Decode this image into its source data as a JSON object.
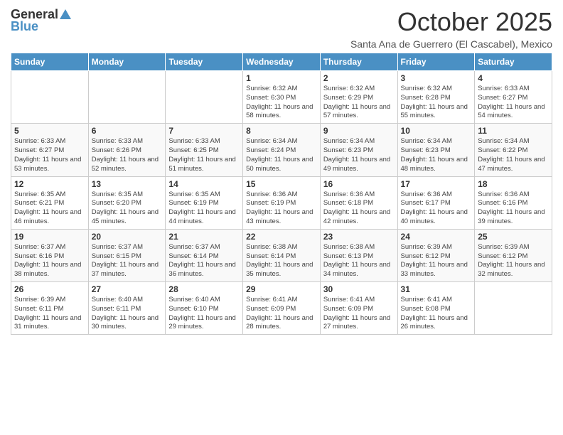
{
  "logo": {
    "general": "General",
    "blue": "Blue"
  },
  "header": {
    "month": "October 2025",
    "subtitle": "Santa Ana de Guerrero (El Cascabel), Mexico"
  },
  "weekdays": [
    "Sunday",
    "Monday",
    "Tuesday",
    "Wednesday",
    "Thursday",
    "Friday",
    "Saturday"
  ],
  "weeks": [
    [
      {
        "day": "",
        "info": ""
      },
      {
        "day": "",
        "info": ""
      },
      {
        "day": "",
        "info": ""
      },
      {
        "day": "1",
        "info": "Sunrise: 6:32 AM\nSunset: 6:30 PM\nDaylight: 11 hours and 58 minutes."
      },
      {
        "day": "2",
        "info": "Sunrise: 6:32 AM\nSunset: 6:29 PM\nDaylight: 11 hours and 57 minutes."
      },
      {
        "day": "3",
        "info": "Sunrise: 6:32 AM\nSunset: 6:28 PM\nDaylight: 11 hours and 55 minutes."
      },
      {
        "day": "4",
        "info": "Sunrise: 6:33 AM\nSunset: 6:27 PM\nDaylight: 11 hours and 54 minutes."
      }
    ],
    [
      {
        "day": "5",
        "info": "Sunrise: 6:33 AM\nSunset: 6:27 PM\nDaylight: 11 hours and 53 minutes."
      },
      {
        "day": "6",
        "info": "Sunrise: 6:33 AM\nSunset: 6:26 PM\nDaylight: 11 hours and 52 minutes."
      },
      {
        "day": "7",
        "info": "Sunrise: 6:33 AM\nSunset: 6:25 PM\nDaylight: 11 hours and 51 minutes."
      },
      {
        "day": "8",
        "info": "Sunrise: 6:34 AM\nSunset: 6:24 PM\nDaylight: 11 hours and 50 minutes."
      },
      {
        "day": "9",
        "info": "Sunrise: 6:34 AM\nSunset: 6:23 PM\nDaylight: 11 hours and 49 minutes."
      },
      {
        "day": "10",
        "info": "Sunrise: 6:34 AM\nSunset: 6:23 PM\nDaylight: 11 hours and 48 minutes."
      },
      {
        "day": "11",
        "info": "Sunrise: 6:34 AM\nSunset: 6:22 PM\nDaylight: 11 hours and 47 minutes."
      }
    ],
    [
      {
        "day": "12",
        "info": "Sunrise: 6:35 AM\nSunset: 6:21 PM\nDaylight: 11 hours and 46 minutes."
      },
      {
        "day": "13",
        "info": "Sunrise: 6:35 AM\nSunset: 6:20 PM\nDaylight: 11 hours and 45 minutes."
      },
      {
        "day": "14",
        "info": "Sunrise: 6:35 AM\nSunset: 6:19 PM\nDaylight: 11 hours and 44 minutes."
      },
      {
        "day": "15",
        "info": "Sunrise: 6:36 AM\nSunset: 6:19 PM\nDaylight: 11 hours and 43 minutes."
      },
      {
        "day": "16",
        "info": "Sunrise: 6:36 AM\nSunset: 6:18 PM\nDaylight: 11 hours and 42 minutes."
      },
      {
        "day": "17",
        "info": "Sunrise: 6:36 AM\nSunset: 6:17 PM\nDaylight: 11 hours and 40 minutes."
      },
      {
        "day": "18",
        "info": "Sunrise: 6:36 AM\nSunset: 6:16 PM\nDaylight: 11 hours and 39 minutes."
      }
    ],
    [
      {
        "day": "19",
        "info": "Sunrise: 6:37 AM\nSunset: 6:16 PM\nDaylight: 11 hours and 38 minutes."
      },
      {
        "day": "20",
        "info": "Sunrise: 6:37 AM\nSunset: 6:15 PM\nDaylight: 11 hours and 37 minutes."
      },
      {
        "day": "21",
        "info": "Sunrise: 6:37 AM\nSunset: 6:14 PM\nDaylight: 11 hours and 36 minutes."
      },
      {
        "day": "22",
        "info": "Sunrise: 6:38 AM\nSunset: 6:14 PM\nDaylight: 11 hours and 35 minutes."
      },
      {
        "day": "23",
        "info": "Sunrise: 6:38 AM\nSunset: 6:13 PM\nDaylight: 11 hours and 34 minutes."
      },
      {
        "day": "24",
        "info": "Sunrise: 6:39 AM\nSunset: 6:12 PM\nDaylight: 11 hours and 33 minutes."
      },
      {
        "day": "25",
        "info": "Sunrise: 6:39 AM\nSunset: 6:12 PM\nDaylight: 11 hours and 32 minutes."
      }
    ],
    [
      {
        "day": "26",
        "info": "Sunrise: 6:39 AM\nSunset: 6:11 PM\nDaylight: 11 hours and 31 minutes."
      },
      {
        "day": "27",
        "info": "Sunrise: 6:40 AM\nSunset: 6:11 PM\nDaylight: 11 hours and 30 minutes."
      },
      {
        "day": "28",
        "info": "Sunrise: 6:40 AM\nSunset: 6:10 PM\nDaylight: 11 hours and 29 minutes."
      },
      {
        "day": "29",
        "info": "Sunrise: 6:41 AM\nSunset: 6:09 PM\nDaylight: 11 hours and 28 minutes."
      },
      {
        "day": "30",
        "info": "Sunrise: 6:41 AM\nSunset: 6:09 PM\nDaylight: 11 hours and 27 minutes."
      },
      {
        "day": "31",
        "info": "Sunrise: 6:41 AM\nSunset: 6:08 PM\nDaylight: 11 hours and 26 minutes."
      },
      {
        "day": "",
        "info": ""
      }
    ]
  ]
}
